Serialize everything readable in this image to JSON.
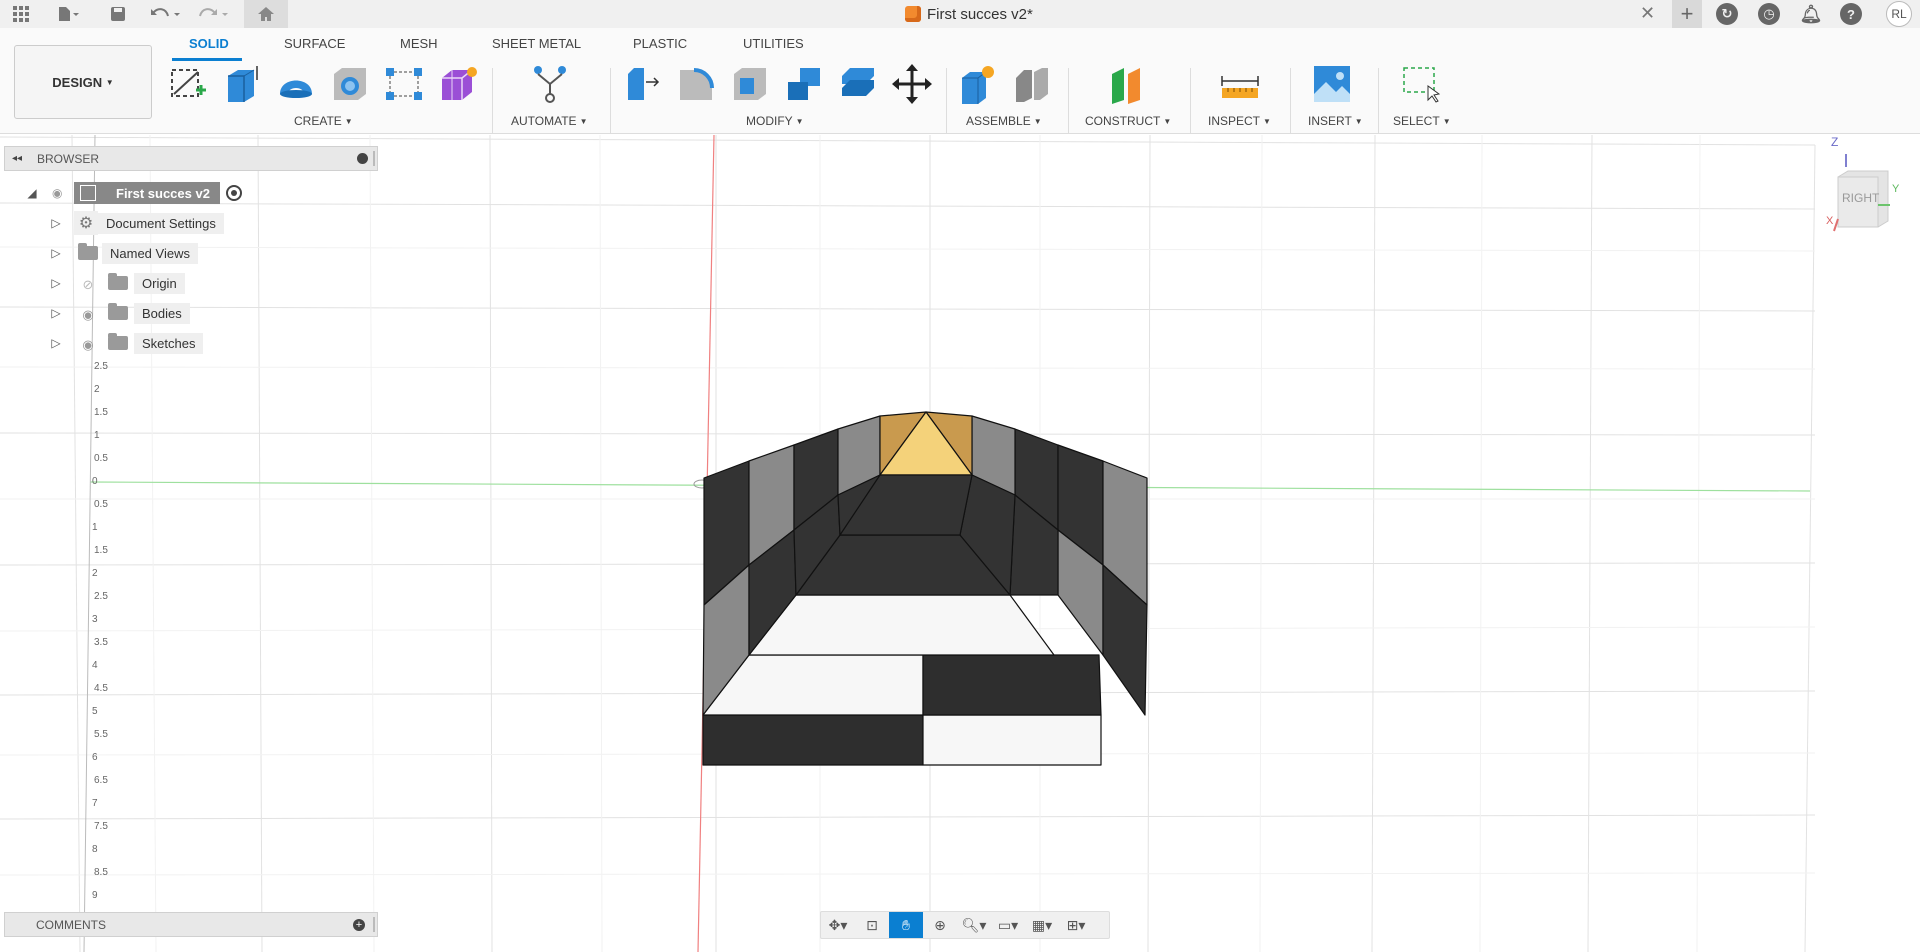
{
  "titlebar": {
    "doc_title": "First succes v2*",
    "close": "✕",
    "avatar": "RL"
  },
  "ribbon": {
    "workspace": "DESIGN",
    "tabs": [
      "SOLID",
      "SURFACE",
      "MESH",
      "SHEET METAL",
      "PLASTIC",
      "UTILITIES"
    ],
    "groups": [
      "CREATE",
      "AUTOMATE",
      "MODIFY",
      "ASSEMBLE",
      "CONSTRUCT",
      "INSPECT",
      "INSERT",
      "SELECT"
    ]
  },
  "browser": {
    "title": "BROWSER",
    "root": "First succes v2",
    "items": [
      "Document Settings",
      "Named Views",
      "Origin",
      "Bodies",
      "Sketches"
    ]
  },
  "comments": {
    "title": "COMMENTS"
  },
  "viewcube": {
    "face": "RIGHT",
    "axis_z": "Z",
    "axis_y": "Y",
    "axis_x": "X"
  },
  "ruler": {
    "labels": [
      "2.5",
      "2",
      "1.5",
      "1",
      "0.5",
      "0",
      "0.5",
      "1",
      "1.5",
      "2",
      "2.5",
      "3",
      "3.5",
      "4",
      "4.5",
      "5",
      "5.5",
      "6",
      "6.5",
      "7",
      "7.5",
      "8",
      "8.5",
      "9"
    ]
  },
  "colors": {
    "accent": "#0b7fd1",
    "axis_red": "#f08080",
    "axis_green": "#9ee09e"
  }
}
